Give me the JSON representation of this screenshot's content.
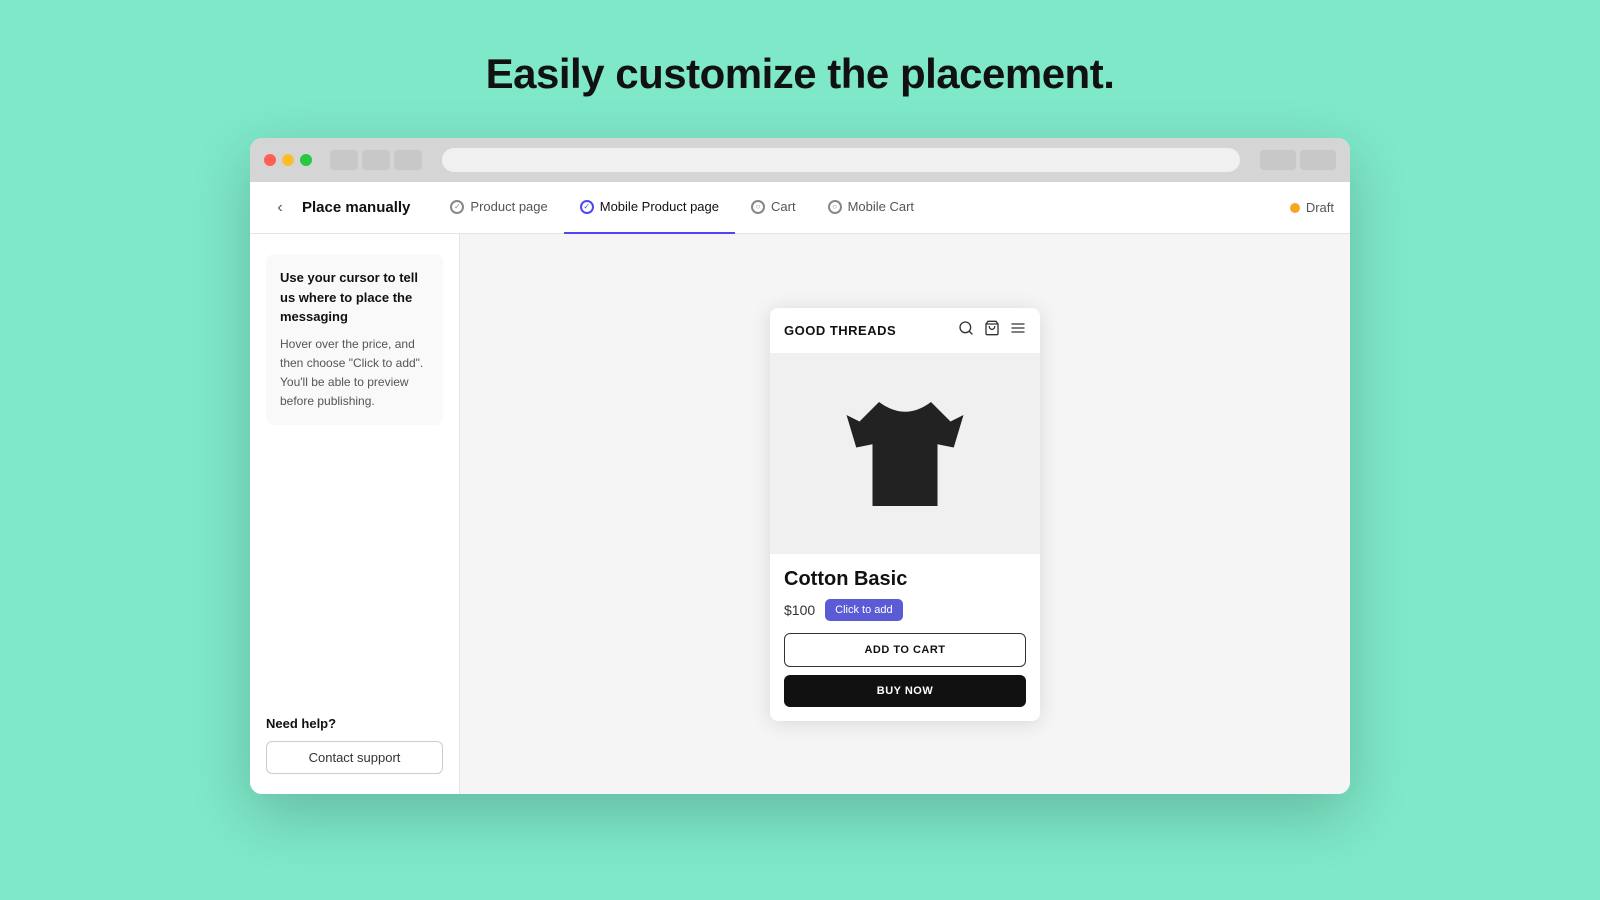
{
  "page": {
    "heading": "Easily customize the placement."
  },
  "browser": {
    "traffic_lights": [
      "red",
      "yellow",
      "green"
    ]
  },
  "top_nav": {
    "back_label": "‹",
    "page_title": "Place manually",
    "tabs": [
      {
        "id": "product-page",
        "label": "Product page",
        "active": false
      },
      {
        "id": "mobile-product-page",
        "label": "Mobile Product page",
        "active": true
      },
      {
        "id": "cart",
        "label": "Cart",
        "active": false
      },
      {
        "id": "mobile-cart",
        "label": "Mobile Cart",
        "active": false
      }
    ],
    "draft_label": "Draft"
  },
  "sidebar": {
    "instruction_title": "Use your cursor to tell us where to place the messaging",
    "instruction_body": "Hover over the price, and then choose \"Click to add\". You'll be able to preview before publishing.",
    "need_help_label": "Need help?",
    "contact_support_label": "Contact support"
  },
  "mobile_preview": {
    "store_name": "GOOD THREADS",
    "product_name": "Cotton Basic",
    "price": "$100",
    "click_to_add_label": "Click to add",
    "add_to_cart_label": "ADD TO CART",
    "buy_now_label": "BUY NOW"
  }
}
